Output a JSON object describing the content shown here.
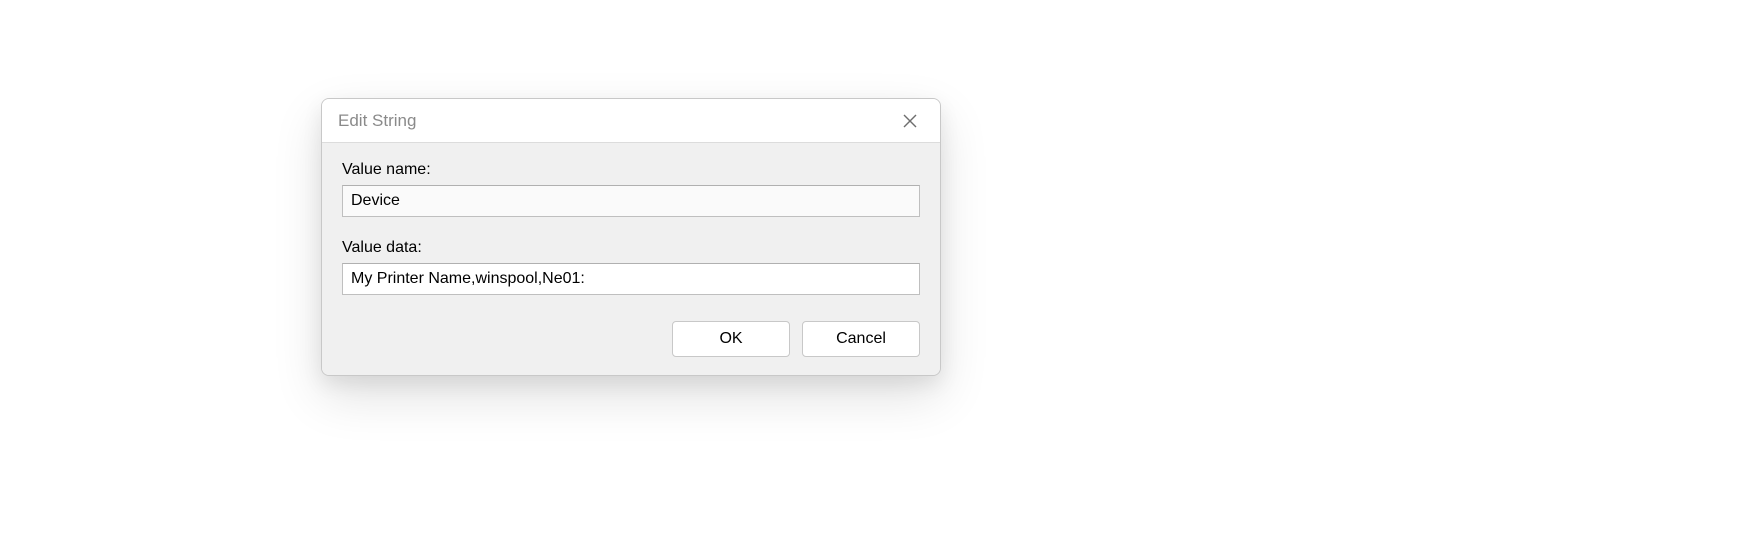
{
  "dialog": {
    "title": "Edit String",
    "value_name_label": "Value name:",
    "value_name": "Device",
    "value_data_label": "Value data:",
    "value_data": "My Printer Name,winspool,Ne01:",
    "ok_label": "OK",
    "cancel_label": "Cancel"
  }
}
